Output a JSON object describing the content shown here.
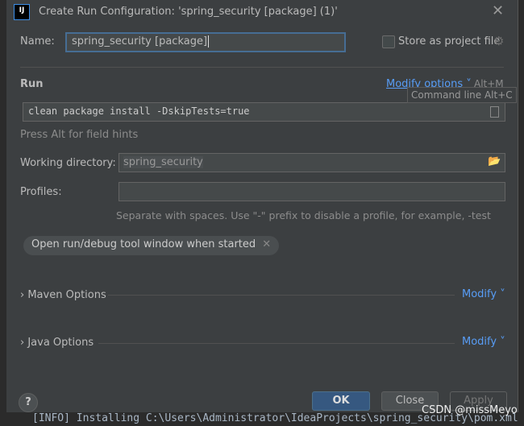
{
  "title": "Create Run Configuration: 'spring_security [package] (1)'",
  "name_label": "Name:",
  "name_value": "spring_security [package]",
  "store_label": "Store as project file",
  "run_label": "Run",
  "modify_options": "Modify options",
  "modify_shortcut": "Alt+M",
  "tooltip": "Command line Alt+C",
  "command": "clean package install -DskipTests=true",
  "hint": "Press Alt for field hints",
  "workdir_label": "Working directory:",
  "workdir_value": "spring_security",
  "profiles_label": "Profiles:",
  "profiles_value": "",
  "profiles_hint": "Separate with spaces. Use \"-\" prefix to disable a profile, for example, -test",
  "chip": "Open run/debug tool window when started",
  "maven_options": "Maven Options",
  "java_options": "Java Options",
  "modify": "Modify",
  "ok": "OK",
  "close": "Close",
  "apply": "Apply",
  "watermark": "CSDN @missMeyo",
  "background_log": "[INFO] Installing C:\\Users\\Administrator\\IdeaProjects\\spring_security\\pom.xml"
}
